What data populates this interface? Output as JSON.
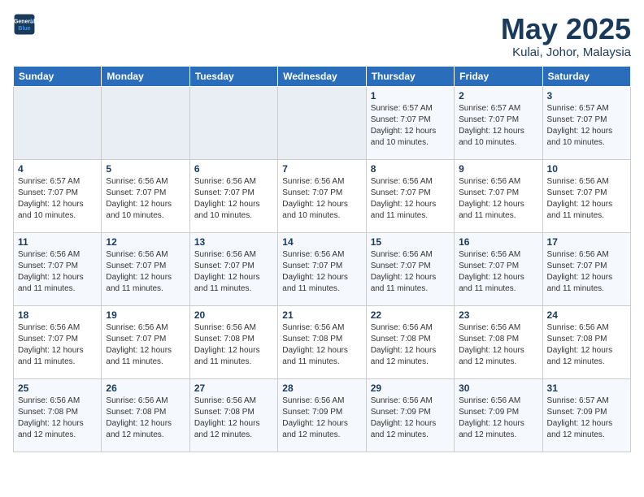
{
  "header": {
    "logo_line1": "General",
    "logo_line2": "Blue",
    "month_title": "May 2025",
    "location": "Kulai, Johor, Malaysia"
  },
  "weekdays": [
    "Sunday",
    "Monday",
    "Tuesday",
    "Wednesday",
    "Thursday",
    "Friday",
    "Saturday"
  ],
  "weeks": [
    [
      {
        "day": "",
        "info": ""
      },
      {
        "day": "",
        "info": ""
      },
      {
        "day": "",
        "info": ""
      },
      {
        "day": "",
        "info": ""
      },
      {
        "day": "1",
        "info": "Sunrise: 6:57 AM\nSunset: 7:07 PM\nDaylight: 12 hours\nand 10 minutes."
      },
      {
        "day": "2",
        "info": "Sunrise: 6:57 AM\nSunset: 7:07 PM\nDaylight: 12 hours\nand 10 minutes."
      },
      {
        "day": "3",
        "info": "Sunrise: 6:57 AM\nSunset: 7:07 PM\nDaylight: 12 hours\nand 10 minutes."
      }
    ],
    [
      {
        "day": "4",
        "info": "Sunrise: 6:57 AM\nSunset: 7:07 PM\nDaylight: 12 hours\nand 10 minutes."
      },
      {
        "day": "5",
        "info": "Sunrise: 6:56 AM\nSunset: 7:07 PM\nDaylight: 12 hours\nand 10 minutes."
      },
      {
        "day": "6",
        "info": "Sunrise: 6:56 AM\nSunset: 7:07 PM\nDaylight: 12 hours\nand 10 minutes."
      },
      {
        "day": "7",
        "info": "Sunrise: 6:56 AM\nSunset: 7:07 PM\nDaylight: 12 hours\nand 10 minutes."
      },
      {
        "day": "8",
        "info": "Sunrise: 6:56 AM\nSunset: 7:07 PM\nDaylight: 12 hours\nand 11 minutes."
      },
      {
        "day": "9",
        "info": "Sunrise: 6:56 AM\nSunset: 7:07 PM\nDaylight: 12 hours\nand 11 minutes."
      },
      {
        "day": "10",
        "info": "Sunrise: 6:56 AM\nSunset: 7:07 PM\nDaylight: 12 hours\nand 11 minutes."
      }
    ],
    [
      {
        "day": "11",
        "info": "Sunrise: 6:56 AM\nSunset: 7:07 PM\nDaylight: 12 hours\nand 11 minutes."
      },
      {
        "day": "12",
        "info": "Sunrise: 6:56 AM\nSunset: 7:07 PM\nDaylight: 12 hours\nand 11 minutes."
      },
      {
        "day": "13",
        "info": "Sunrise: 6:56 AM\nSunset: 7:07 PM\nDaylight: 12 hours\nand 11 minutes."
      },
      {
        "day": "14",
        "info": "Sunrise: 6:56 AM\nSunset: 7:07 PM\nDaylight: 12 hours\nand 11 minutes."
      },
      {
        "day": "15",
        "info": "Sunrise: 6:56 AM\nSunset: 7:07 PM\nDaylight: 12 hours\nand 11 minutes."
      },
      {
        "day": "16",
        "info": "Sunrise: 6:56 AM\nSunset: 7:07 PM\nDaylight: 12 hours\nand 11 minutes."
      },
      {
        "day": "17",
        "info": "Sunrise: 6:56 AM\nSunset: 7:07 PM\nDaylight: 12 hours\nand 11 minutes."
      }
    ],
    [
      {
        "day": "18",
        "info": "Sunrise: 6:56 AM\nSunset: 7:07 PM\nDaylight: 12 hours\nand 11 minutes."
      },
      {
        "day": "19",
        "info": "Sunrise: 6:56 AM\nSunset: 7:07 PM\nDaylight: 12 hours\nand 11 minutes."
      },
      {
        "day": "20",
        "info": "Sunrise: 6:56 AM\nSunset: 7:08 PM\nDaylight: 12 hours\nand 11 minutes."
      },
      {
        "day": "21",
        "info": "Sunrise: 6:56 AM\nSunset: 7:08 PM\nDaylight: 12 hours\nand 11 minutes."
      },
      {
        "day": "22",
        "info": "Sunrise: 6:56 AM\nSunset: 7:08 PM\nDaylight: 12 hours\nand 12 minutes."
      },
      {
        "day": "23",
        "info": "Sunrise: 6:56 AM\nSunset: 7:08 PM\nDaylight: 12 hours\nand 12 minutes."
      },
      {
        "day": "24",
        "info": "Sunrise: 6:56 AM\nSunset: 7:08 PM\nDaylight: 12 hours\nand 12 minutes."
      }
    ],
    [
      {
        "day": "25",
        "info": "Sunrise: 6:56 AM\nSunset: 7:08 PM\nDaylight: 12 hours\nand 12 minutes."
      },
      {
        "day": "26",
        "info": "Sunrise: 6:56 AM\nSunset: 7:08 PM\nDaylight: 12 hours\nand 12 minutes."
      },
      {
        "day": "27",
        "info": "Sunrise: 6:56 AM\nSunset: 7:08 PM\nDaylight: 12 hours\nand 12 minutes."
      },
      {
        "day": "28",
        "info": "Sunrise: 6:56 AM\nSunset: 7:09 PM\nDaylight: 12 hours\nand 12 minutes."
      },
      {
        "day": "29",
        "info": "Sunrise: 6:56 AM\nSunset: 7:09 PM\nDaylight: 12 hours\nand 12 minutes."
      },
      {
        "day": "30",
        "info": "Sunrise: 6:56 AM\nSunset: 7:09 PM\nDaylight: 12 hours\nand 12 minutes."
      },
      {
        "day": "31",
        "info": "Sunrise: 6:57 AM\nSunset: 7:09 PM\nDaylight: 12 hours\nand 12 minutes."
      }
    ]
  ]
}
